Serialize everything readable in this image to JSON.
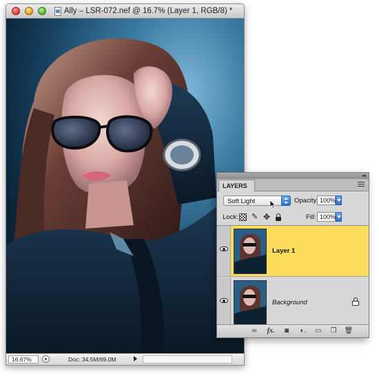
{
  "document": {
    "title": "Ally – LSR-072.nef @ 16.7% (Layer 1, RGB/8) *",
    "zoom": "16.67%",
    "doc_size": "Doc: 34.5M/69.0M"
  },
  "layers_panel": {
    "tab_label": "LAYERS",
    "blend_mode": "Soft Light",
    "opacity_label": "Opacity:",
    "opacity_value": "100%",
    "lock_label": "Lock:",
    "fill_label": "Fill:",
    "fill_value": "100%",
    "layers": [
      {
        "name": "Layer 1",
        "selected": true,
        "visible": true,
        "locked": false
      },
      {
        "name": "Background",
        "selected": false,
        "visible": true,
        "locked": true
      }
    ],
    "footer_icons": [
      "link-layers-icon",
      "fx-icon",
      "add-mask-icon",
      "adjustment-layer-icon",
      "new-group-icon",
      "new-layer-icon",
      "trash-icon"
    ]
  },
  "colors": {
    "selected_layer": "#fdde5c",
    "panel_bg": "#d7d7d7",
    "accent_blue": "#2f6fcf"
  }
}
